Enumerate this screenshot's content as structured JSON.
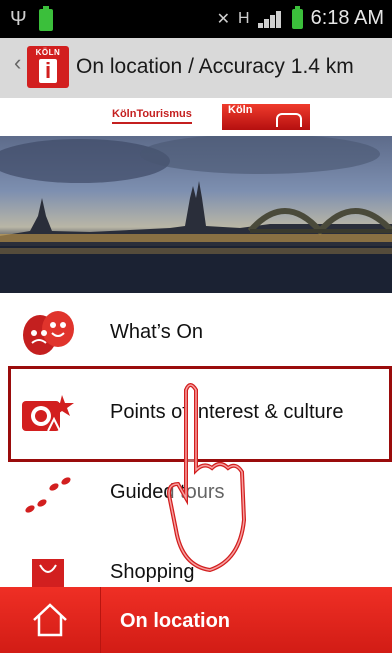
{
  "status_bar": {
    "time": "6:18 AM",
    "network_label": "H"
  },
  "header": {
    "logo_text": "KÖLN",
    "title": "On location / Accuracy 1.4 km"
  },
  "brand": {
    "tourismus": "KölnTourismus",
    "koln_badge": "Köln"
  },
  "menu": [
    {
      "label": "What’s On",
      "icon": "theater-masks-icon"
    },
    {
      "label": "Points of interest & culture",
      "icon": "sights-camera-icon"
    },
    {
      "label": "Guided tours",
      "icon": "footprints-icon"
    },
    {
      "label": "Shopping",
      "icon": "shopping-bag-icon"
    }
  ],
  "bottom_bar": {
    "label": "On location",
    "home_icon": "home-icon"
  },
  "colors": {
    "accent_red": "#d21f1f",
    "highlight_border": "#9a0c0c"
  }
}
